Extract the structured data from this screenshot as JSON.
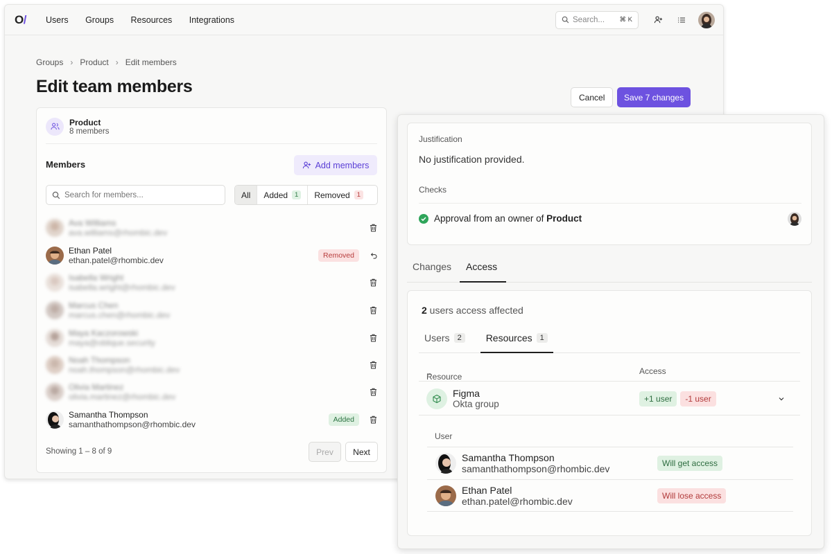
{
  "topbar": {
    "logo": "O/",
    "nav": [
      "Users",
      "Groups",
      "Resources",
      "Integrations"
    ],
    "search_placeholder": "Search...",
    "search_shortcut": "⌘ K"
  },
  "breadcrumb": [
    "Groups",
    "Product",
    "Edit members"
  ],
  "page_title": "Edit team members",
  "actions": {
    "cancel": "Cancel",
    "save": "Save 7 changes"
  },
  "group": {
    "name": "Product",
    "count": "8 members"
  },
  "members": {
    "label": "Members",
    "add_button": "Add members",
    "search_placeholder": "Search for members...",
    "filters": [
      {
        "label": "All",
        "count": ""
      },
      {
        "label": "Added",
        "count": "1"
      },
      {
        "label": "Removed",
        "count": "1"
      }
    ],
    "rows": [
      {
        "name": "Ava Williams",
        "email": "ava.williams@rhombic.dev",
        "badge": ""
      },
      {
        "name": "Ethan Patel",
        "email": "ethan.patel@rhombic.dev",
        "badge": "Removed"
      },
      {
        "name": "Isabella Wright",
        "email": "isabella.wright@rhombic.dev",
        "badge": ""
      },
      {
        "name": "Marcus Chen",
        "email": "marcus.chen@rhombic.dev",
        "badge": ""
      },
      {
        "name": "Maya Kaczorowski",
        "email": "maya@oblique.security",
        "badge": ""
      },
      {
        "name": "Noah Thompson",
        "email": "noah.thompson@rhombic.dev",
        "badge": ""
      },
      {
        "name": "Olivia Martinez",
        "email": "olivia.martinez@rhombic.dev",
        "badge": ""
      },
      {
        "name": "Samantha Thompson",
        "email": "samanthathompson@rhombic.dev",
        "badge": "Added"
      }
    ],
    "showing": "Showing 1 – 8 of 9",
    "prev": "Prev",
    "next": "Next"
  },
  "panel": {
    "justification_label": "Justification",
    "justification_value": "No justification provided.",
    "checks_label": "Checks",
    "check_prefix": "Approval from an owner of ",
    "check_group": "Product",
    "tabs": [
      "Changes",
      "Access"
    ],
    "affected_count": "2",
    "affected_text": " users access affected",
    "subtabs": [
      {
        "label": "Users",
        "count": "2"
      },
      {
        "label": "Resources",
        "count": "1"
      }
    ],
    "table_headers": {
      "resource": "Resource",
      "access": "Access"
    },
    "resource": {
      "name": "Figma",
      "type": "Okta group",
      "plus": "+1 user",
      "minus": "-1 user"
    },
    "user_header": "User",
    "users": [
      {
        "name": "Samantha Thompson",
        "email": "samanthathompson@rhombic.dev",
        "status": "Will get access"
      },
      {
        "name": "Ethan Patel",
        "email": "ethan.patel@rhombic.dev",
        "status": "Will lose access"
      }
    ]
  },
  "colors": {
    "accent": "#6d52e0",
    "added": "#dff1e2",
    "removed": "#fbe0e0"
  }
}
